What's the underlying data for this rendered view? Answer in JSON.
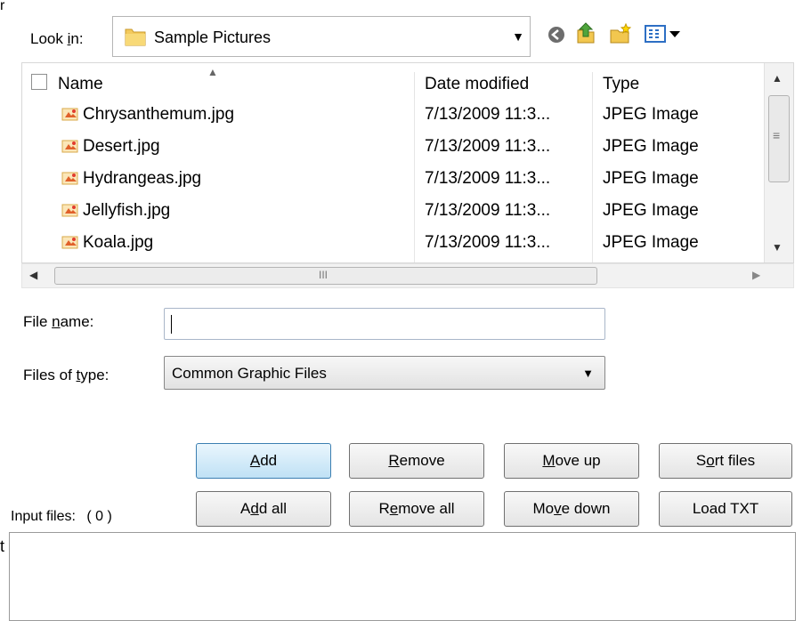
{
  "look_in": {
    "label_pre": "Look ",
    "label_key": "i",
    "label_post": "n:",
    "value": "Sample Pictures"
  },
  "toolbar": {
    "back_icon": "back-circle-icon",
    "up_icon": "up-folder-icon",
    "new_folder_icon": "new-folder-icon",
    "view_icon": "view-menu-icon"
  },
  "file_list": {
    "columns": [
      "Name",
      "Date modified",
      "Type"
    ],
    "rows": [
      {
        "name": "Chrysanthemum.jpg",
        "date": "7/13/2009 11:3...",
        "type": "JPEG Image"
      },
      {
        "name": "Desert.jpg",
        "date": "7/13/2009 11:3...",
        "type": "JPEG Image"
      },
      {
        "name": "Hydrangeas.jpg",
        "date": "7/13/2009 11:3...",
        "type": "JPEG Image"
      },
      {
        "name": "Jellyfish.jpg",
        "date": "7/13/2009 11:3...",
        "type": "JPEG Image"
      },
      {
        "name": "Koala.jpg",
        "date": "7/13/2009 11:3...",
        "type": "JPEG Image"
      }
    ],
    "hscroll_grip": "III",
    "vscroll_grip": "≡"
  },
  "file_name": {
    "label_pre": "File ",
    "label_key": "n",
    "label_post": "ame:",
    "value": ""
  },
  "files_of_type": {
    "label_pre": "Files of ",
    "label_key": "t",
    "label_post": "ype:",
    "value": "Common Graphic Files"
  },
  "buttons": {
    "add": {
      "pre": "",
      "key": "A",
      "post": "dd"
    },
    "remove": {
      "pre": "",
      "key": "R",
      "post": "emove"
    },
    "move_up": {
      "pre": "",
      "key": "M",
      "post": "ove up"
    },
    "sort_files": {
      "pre": "S",
      "key": "o",
      "post": "rt files"
    },
    "add_all": {
      "pre": "A",
      "key": "d",
      "post": "d all"
    },
    "remove_all": {
      "pre": "R",
      "key": "e",
      "post": "move all"
    },
    "move_down": {
      "pre": "Mo",
      "key": "v",
      "post": "e down"
    },
    "load_txt": {
      "pre": "Load TXT",
      "key": "",
      "post": ""
    }
  },
  "input_files": {
    "label": "Input files:",
    "count": "( 0 )"
  },
  "edge_fragments": {
    "top_left": "r",
    "bottom_left": "t"
  }
}
